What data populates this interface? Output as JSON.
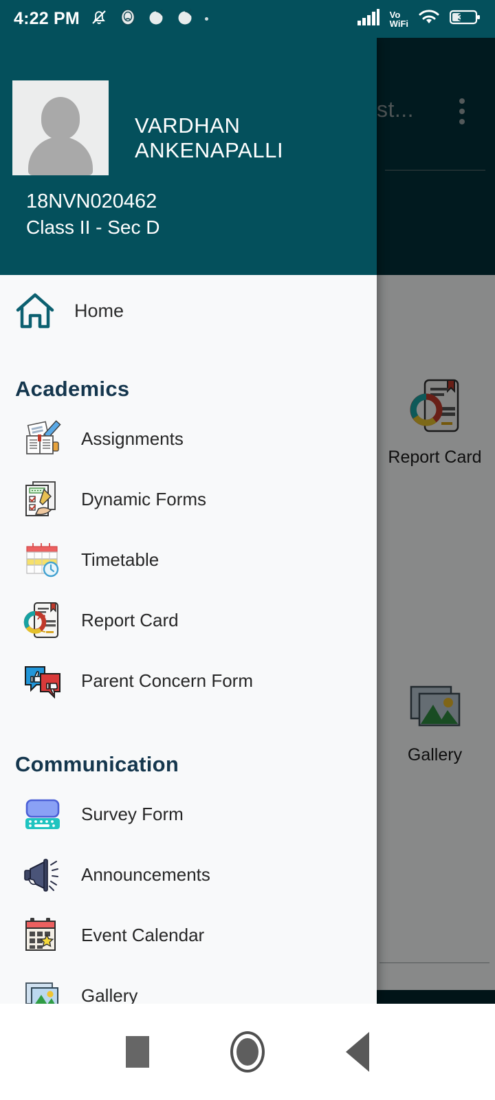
{
  "statusbar": {
    "time": "4:22 PM",
    "icons": [
      "bell-muted-icon",
      "app-icon-1",
      "app-icon-2",
      "app-icon-3",
      "dot-icon"
    ],
    "network": "Vo",
    "network_sub": "WiFi",
    "battery_level": "30",
    "signal_icon": "signal-bars-icon",
    "wifi_icon": "wifi-icon"
  },
  "background_app": {
    "title": "st...",
    "overflow_icon": "kebab-menu-icon",
    "tiles": [
      {
        "label": "Report Card",
        "icon": "report-card-icon"
      },
      {
        "label": "Gallery",
        "icon": "gallery-icon"
      }
    ],
    "social_icon": "instagram-icon"
  },
  "drawer": {
    "student": {
      "name": "VARDHAN ANKENAPALLI",
      "id": "18NVN020462",
      "class": "Class II - Sec D",
      "avatar_icon": "avatar-placeholder-icon"
    },
    "home": {
      "label": "Home",
      "icon": "home-icon"
    },
    "sections": [
      {
        "title": "Academics",
        "items": [
          {
            "label": "Assignments",
            "icon": "assignments-icon"
          },
          {
            "label": "Dynamic Forms",
            "icon": "dynamic-forms-icon"
          },
          {
            "label": "Timetable",
            "icon": "timetable-icon"
          },
          {
            "label": "Report Card",
            "icon": "report-card-icon"
          },
          {
            "label": "Parent Concern Form",
            "icon": "parent-concern-icon"
          }
        ]
      },
      {
        "title": "Communication",
        "items": [
          {
            "label": "Survey Form",
            "icon": "survey-form-icon"
          },
          {
            "label": "Announcements",
            "icon": "announcements-icon"
          },
          {
            "label": "Event Calendar",
            "icon": "event-calendar-icon"
          },
          {
            "label": "Gallery",
            "icon": "gallery-icon"
          }
        ]
      }
    ]
  },
  "navbar": {
    "recents": "recents-button",
    "home": "home-button",
    "back": "back-button"
  },
  "colors": {
    "header_teal": "#04505c",
    "appbar_dark": "#03303a",
    "drawer_bg": "#f8f9fa",
    "section_title": "#14364d"
  }
}
